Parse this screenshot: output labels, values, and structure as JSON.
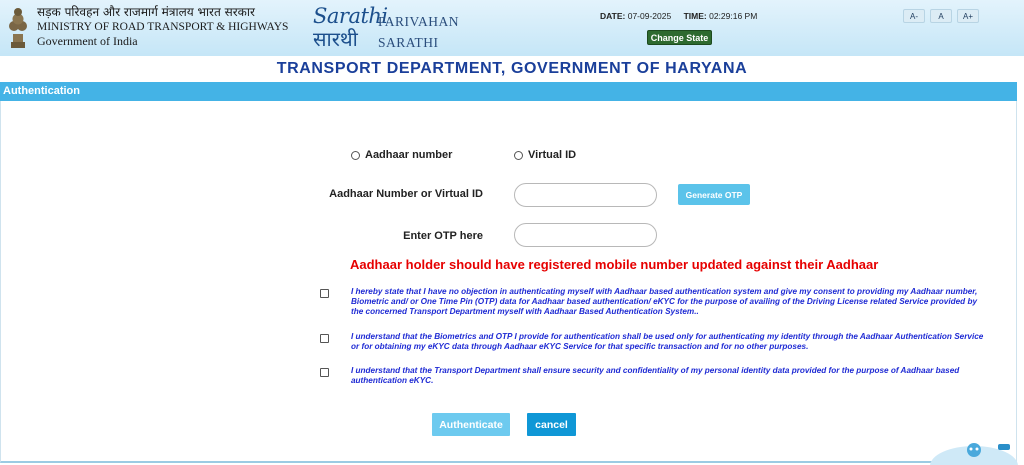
{
  "header": {
    "ministry_hindi": "सड़क परिवहन और राजमार्ग मंत्रालय भारत सरकार",
    "ministry_english": "MINISTRY OF ROAD TRANSPORT & HIGHWAYS",
    "government": "Government of India",
    "logo_script": "Sarathi",
    "logo_hindi": "सारथी",
    "brand_line1": "PARIVAHAN",
    "brand_line2": "SARATHI",
    "date_label": "DATE:",
    "date_value": "07-09-2025",
    "time_label": "TIME:",
    "time_value": "02:29:16 PM",
    "change_state_label": "Change State",
    "font_decrease": "A-",
    "font_normal": "A",
    "font_increase": "A+"
  },
  "department_title": "TRANSPORT DEPARTMENT, GOVERNMENT OF HARYANA",
  "section_title": "Authentication",
  "form": {
    "radio_aadhaar": "Aadhaar number",
    "radio_virtual": "Virtual ID",
    "id_label": "Aadhaar Number or Virtual ID",
    "id_value": "",
    "generate_otp": "Generate OTP",
    "otp_label": "Enter OTP here",
    "otp_value": "",
    "warning": "Aadhaar holder should have registered mobile number updated against their Aadhaar"
  },
  "consents": [
    {
      "text": "I hereby state that I have no objection in authenticating myself with Aadhaar based authentication system and give my consent to providing my Aadhaar number, Biometric and/ or One Time Pin (OTP) data for Aadhaar based authentication/ eKYC for the purpose of availing of the Driving License related Service provided by the concerned Transport Department myself with Aadhaar Based Authentication System.."
    },
    {
      "text": "I understand that the Biometrics and OTP I provide for authentication shall be used only for authenticating my identity through the Aadhaar Authentication Service or for obtaining my eKYC data through Aadhaar eKYC Service for that specific transaction and for no other purposes."
    },
    {
      "text": "I understand that the Transport Department shall ensure security and confidentiality of my personal identity data provided for the purpose of Aadhaar based authentication eKYC."
    }
  ],
  "buttons": {
    "authenticate": "Authenticate",
    "cancel": "cancel"
  },
  "colors": {
    "accent_blue": "#44b3e6",
    "title_blue": "#1a3f9a",
    "warning_red": "#e60000",
    "consent_text": "#1f2bd4",
    "change_state_green": "#2e6a2f"
  }
}
